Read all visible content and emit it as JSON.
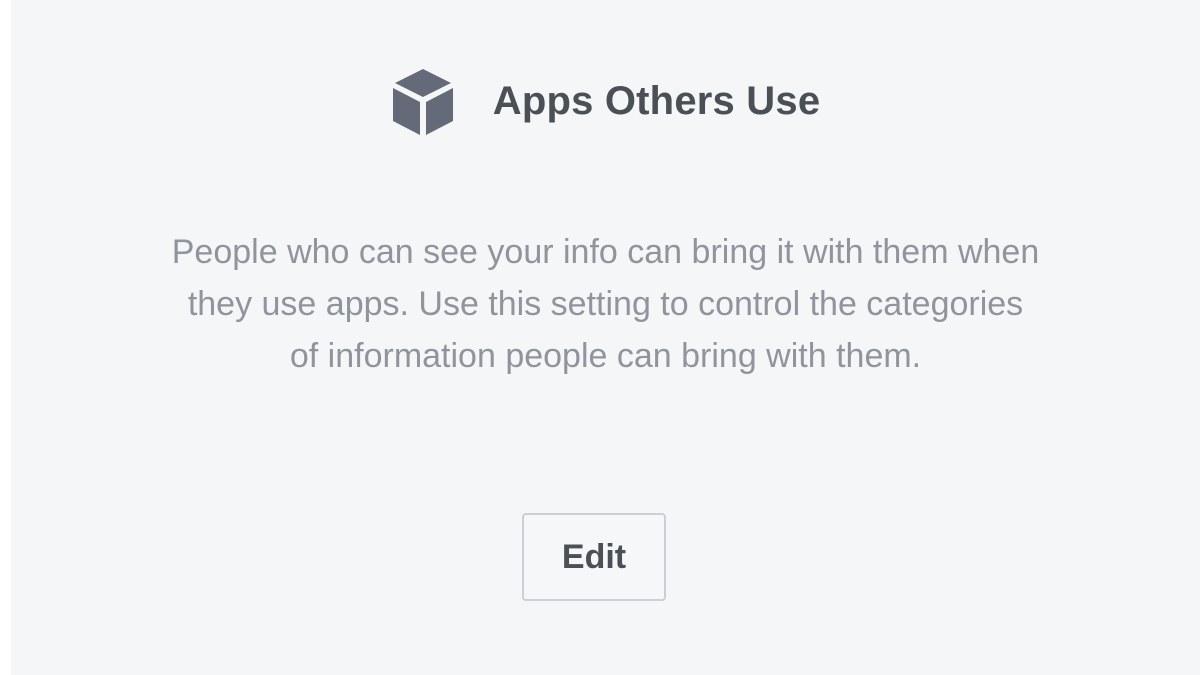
{
  "section": {
    "icon": "cube-icon",
    "title": "Apps Others Use",
    "description_lines": [
      "People who can see your info can bring it with them when",
      "they use apps. Use this setting to control the categories",
      "of information people can bring with them."
    ],
    "edit_label": "Edit"
  },
  "colors": {
    "panel_background": "#f5f6f8",
    "title_text": "#4b4f56",
    "body_text": "#90949c",
    "icon_fill": "#646a78",
    "button_border": "#ccd0d5"
  }
}
